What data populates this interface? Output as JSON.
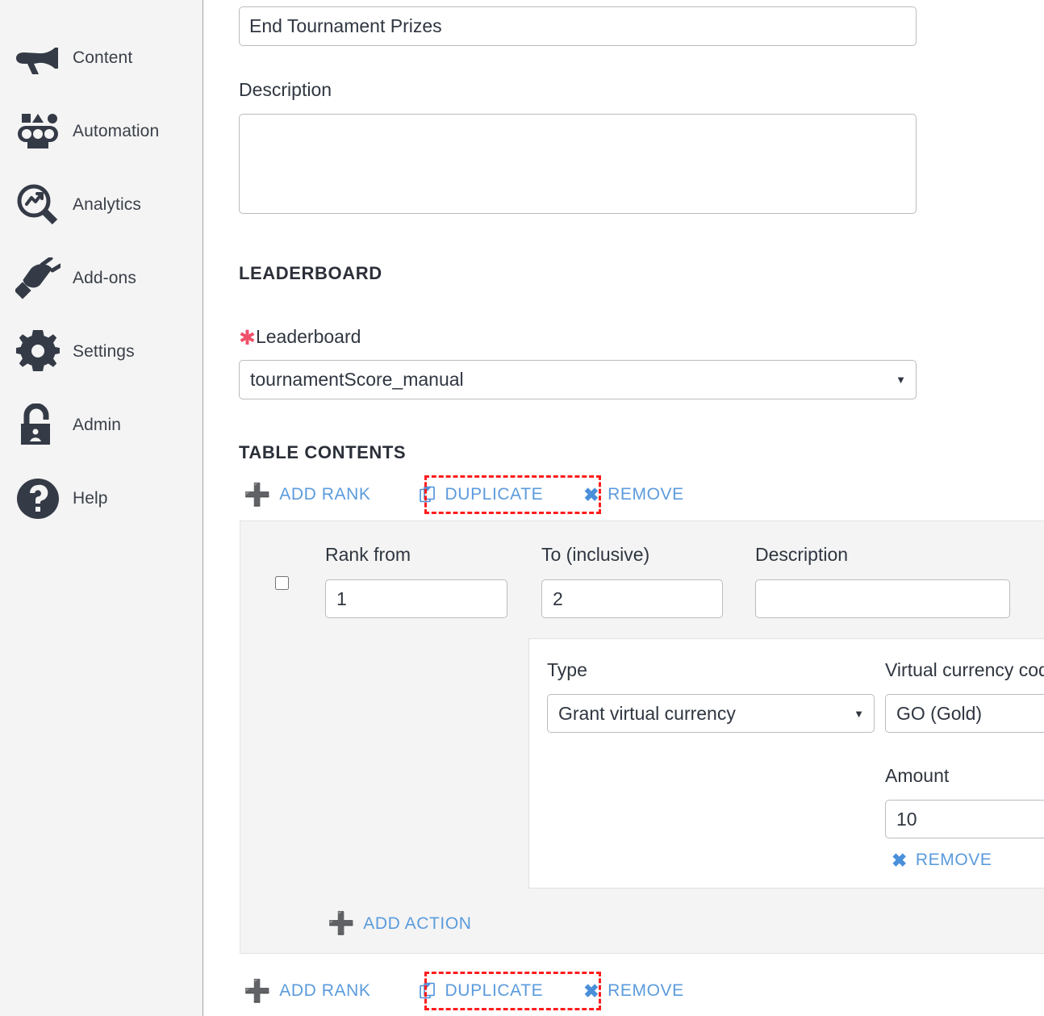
{
  "sidebar": {
    "items": [
      {
        "label": "Content",
        "icon": "megaphone-icon"
      },
      {
        "label": "Automation",
        "icon": "conveyor-icon"
      },
      {
        "label": "Analytics",
        "icon": "magnifier-chart-icon"
      },
      {
        "label": "Add-ons",
        "icon": "plug-icon"
      },
      {
        "label": "Settings",
        "icon": "gear-icon"
      },
      {
        "label": "Admin",
        "icon": "lock-person-icon"
      },
      {
        "label": "Help",
        "icon": "question-circle-icon"
      }
    ]
  },
  "form": {
    "title_value": "End Tournament Prizes",
    "title_placeholder": "",
    "description_label": "Description",
    "description_value": "",
    "description_placeholder": ""
  },
  "leaderboard_section": {
    "heading": "LEADERBOARD",
    "field_label": "Leaderboard",
    "required_mark": "✱",
    "selected": "tournamentScore_manual",
    "caret": "▼"
  },
  "table_contents_section": {
    "heading": "TABLE CONTENTS"
  },
  "toolbar": {
    "add_rank_label": "ADD RANK",
    "add_rank_icon": "plus-icon",
    "duplicate_label": "DUPLICATE",
    "duplicate_icon": "copy-icon",
    "remove_label": "REMOVE",
    "remove_icon": "x-icon"
  },
  "rank_row": {
    "checkbox_checked": false,
    "rank_from_label": "Rank from",
    "rank_from_value": "1",
    "to_inclusive_label": "To (inclusive)",
    "to_inclusive_value": "2",
    "description_label": "Description",
    "description_value": "",
    "description_placeholder": ""
  },
  "action": {
    "type_label": "Type",
    "type_selected": "Grant virtual currency",
    "vcc_label": "Virtual currency code",
    "vcc_selected": "GO (Gold)",
    "amount_label": "Amount",
    "amount_value": "10",
    "remove_label": "REMOVE",
    "remove_icon": "x-icon",
    "add_action_label": "ADD ACTION",
    "add_action_icon": "plus-icon",
    "caret": "▼"
  },
  "colors": {
    "accent_blue": "#5b9bdd",
    "link_blue": "#4a8fda",
    "required_red": "#f0506a",
    "highlight_red": "#ff1d1d",
    "panel_gray": "#f4f4f4",
    "sidebar_gray": "#f4f4f4",
    "text_dark": "#2f3640"
  }
}
